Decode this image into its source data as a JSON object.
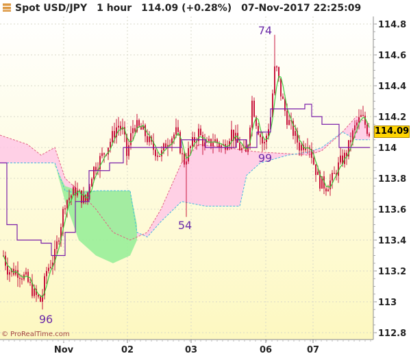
{
  "header": {
    "instrument": "Spot USD/JPY",
    "timeframe": "1 hour",
    "price_change": "114.09 (+0.28%)",
    "datetime": "07-Nov-2017 22:25:09"
  },
  "credit": "© ProRealTime.com",
  "current_price_label": "114.09",
  "chart_data": {
    "type": "candlestick",
    "ylim": [
      112.75,
      114.88
    ],
    "y_ticks": [
      "114.8",
      "114.6",
      "114.4",
      "114.2",
      "114",
      "113.8",
      "113.6",
      "113.4",
      "113.2",
      "113",
      "112.8"
    ],
    "x_ticks": [
      "Nov",
      "02",
      "03",
      "06",
      "07"
    ],
    "annotations": [
      "74",
      "54",
      "99",
      "96"
    ],
    "colors": {
      "background_top": "#ffffff",
      "background_bottom": "#fdf8c0",
      "candle": "#c8143c",
      "conversion_line": "#3cc83c",
      "base_line": "#7a1ea8",
      "cloud_bull": "#99ee99",
      "cloud_bear": "#ffc8e6",
      "current_price_box": "#ffd400"
    }
  }
}
